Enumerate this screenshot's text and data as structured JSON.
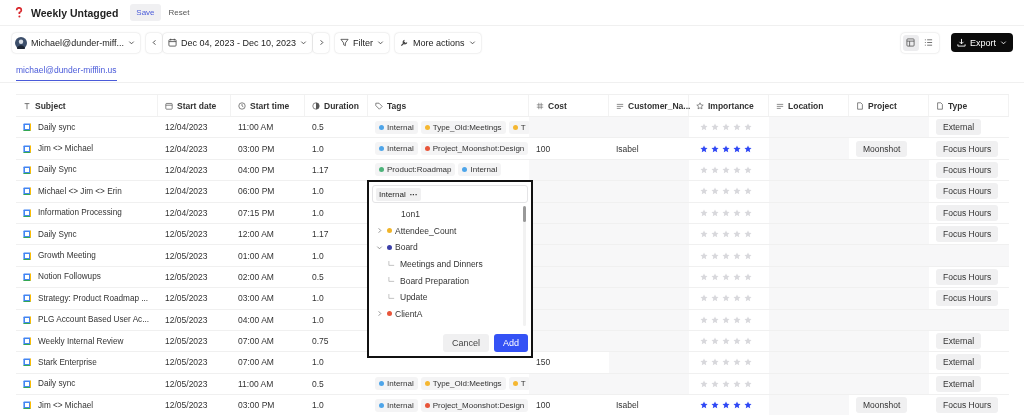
{
  "header": {
    "title": "Weekly Untagged",
    "save": "Save",
    "reset": "Reset"
  },
  "toolbar": {
    "account": "Michael@dunder-miff...",
    "date_range": "Dec 04, 2023 - Dec 10, 2023",
    "filter": "Filter",
    "more_actions": "More actions",
    "views": [
      {
        "kind": "board",
        "selected": true
      },
      {
        "kind": "list",
        "selected": false
      }
    ],
    "export": "Export"
  },
  "tabs": [
    {
      "label": "michael@dunder-mifflin.us",
      "selected": true
    }
  ],
  "table": {
    "columns": [
      {
        "label": "Subject",
        "kind": "title"
      },
      {
        "label": "Start date",
        "kind": "date"
      },
      {
        "label": "Start time",
        "kind": "time"
      },
      {
        "label": "Duration",
        "kind": "duration"
      },
      {
        "label": "Tags",
        "kind": "tags"
      },
      {
        "label": "Cost",
        "kind": "number"
      },
      {
        "label": "Customer_Na...",
        "kind": "text"
      },
      {
        "label": "Importance",
        "kind": "rating"
      },
      {
        "label": "Location",
        "kind": "text"
      },
      {
        "label": "Project",
        "kind": "file"
      },
      {
        "label": "Type",
        "kind": "file"
      }
    ],
    "rows": [
      {
        "subject": "Daily sync",
        "start_date": "12/04/2023",
        "start_time": "11:00 AM",
        "duration": "0.5",
        "tags": [
          {
            "label": "Internal",
            "color": "#4ea5e9"
          },
          {
            "label": "Type_Old:Meetings",
            "color": "#f5b731"
          },
          {
            "label": "T",
            "color": "#f5b731"
          }
        ],
        "stars": 0,
        "type": "External"
      },
      {
        "subject": "Jim <> Michael",
        "start_date": "12/04/2023",
        "start_time": "03:00 PM",
        "duration": "1.0",
        "tags": [
          {
            "label": "Internal",
            "color": "#4ea5e9"
          },
          {
            "label": "Project_Moonshot:Design",
            "color": "#e8553a"
          }
        ],
        "cost": "100",
        "customer": "Isabel",
        "stars": 5,
        "project": "Moonshot",
        "type": "Focus Hours"
      },
      {
        "subject": "Daily Sync",
        "start_date": "12/04/2023",
        "start_time": "04:00 PM",
        "duration": "1.17",
        "tags": [
          {
            "label": "Product:Roadmap",
            "color": "#4cb37a"
          },
          {
            "label": "Internal",
            "color": "#4ea5e9"
          }
        ],
        "stars": 0,
        "type": "Focus Hours"
      },
      {
        "subject": "Michael <> Jim <> Erin",
        "start_date": "12/04/2023",
        "start_time": "06:00 PM",
        "duration": "1.0",
        "stars": 0,
        "type": "Focus Hours"
      },
      {
        "subject": "Information Processing",
        "start_date": "12/04/2023",
        "start_time": "07:15 PM",
        "duration": "1.0",
        "stars": 0,
        "type": "Focus Hours"
      },
      {
        "subject": "Daily Sync",
        "start_date": "12/05/2023",
        "start_time": "12:00 AM",
        "duration": "1.17",
        "stars": 0,
        "type": "Focus Hours"
      },
      {
        "subject": "Growth Meeting",
        "start_date": "12/05/2023",
        "start_time": "01:00 AM",
        "duration": "1.0",
        "stars": 0
      },
      {
        "subject": "Notion Followups",
        "start_date": "12/05/2023",
        "start_time": "02:00 AM",
        "duration": "0.5",
        "stars": 0,
        "type": "Focus Hours"
      },
      {
        "subject": "Strategy: Product Roadmap ...",
        "start_date": "12/05/2023",
        "start_time": "03:00 AM",
        "duration": "1.0",
        "stars": 0,
        "type": "Focus Hours"
      },
      {
        "subject": "PLG Account Based User Ac...",
        "start_date": "12/05/2023",
        "start_time": "04:00 AM",
        "duration": "1.0",
        "stars": 0
      },
      {
        "subject": "Weekly Internal Review",
        "start_date": "12/05/2023",
        "start_time": "07:00 AM",
        "duration": "0.75",
        "stars": 0,
        "type": "External"
      },
      {
        "subject": "Stark Enterprise",
        "start_date": "12/05/2023",
        "start_time": "07:00 AM",
        "duration": "1.0",
        "cost": "150",
        "stars": 0,
        "type": "External"
      },
      {
        "subject": "Daily sync",
        "start_date": "12/05/2023",
        "start_time": "11:00 AM",
        "duration": "0.5",
        "tags": [
          {
            "label": "Internal",
            "color": "#4ea5e9"
          },
          {
            "label": "Type_Old:Meetings",
            "color": "#f5b731"
          },
          {
            "label": "T",
            "color": "#f5b731"
          }
        ],
        "stars": 0,
        "type": "External"
      },
      {
        "subject": "Jim <> Michael",
        "start_date": "12/05/2023",
        "start_time": "03:00 PM",
        "duration": "1.0",
        "tags": [
          {
            "label": "Internal",
            "color": "#4ea5e9"
          },
          {
            "label": "Project_Moonshot:Design",
            "color": "#e8553a"
          }
        ],
        "cost": "100",
        "customer": "Isabel",
        "stars": 5,
        "project": "Moonshot",
        "type": "Focus Hours"
      }
    ]
  },
  "tag_picker": {
    "chips": [
      {
        "label": "Internal",
        "more": "···"
      }
    ],
    "options": [
      {
        "label": "1on1"
      },
      {
        "label": "Attendee_Count",
        "color": "#f0b429",
        "expanded": false
      },
      {
        "label": "Board",
        "color": "#3b3fa8",
        "expanded": true,
        "children": [
          {
            "label": "Meetings and Dinners"
          },
          {
            "label": "Board Preparation"
          },
          {
            "label": "Update"
          }
        ]
      },
      {
        "label": "ClientA",
        "color": "#e8553a",
        "expanded": false
      }
    ],
    "cancel": "Cancel",
    "add": "Add"
  }
}
